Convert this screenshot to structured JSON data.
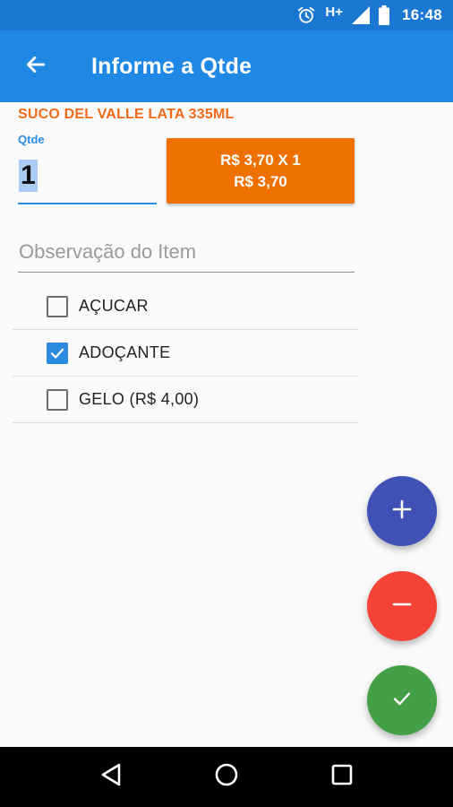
{
  "status_bar": {
    "network": "H+",
    "time": "16:48",
    "icons": [
      "alarm-icon",
      "signal-icon",
      "battery-icon"
    ]
  },
  "toolbar": {
    "title": "Informe a Qtde",
    "back_icon": "arrow-left-icon"
  },
  "product": {
    "name": "SUCO DEL VALLE LATA 335ML"
  },
  "quantity": {
    "label": "Qtde",
    "value": "1"
  },
  "price_button": {
    "line1": "R$ 3,70 X 1",
    "line2": "R$ 3,70"
  },
  "observation": {
    "placeholder": "Observação do Item"
  },
  "options": [
    {
      "label": "AÇUCAR",
      "checked": false
    },
    {
      "label": "ADOÇANTE",
      "checked": true
    },
    {
      "label": "GELO (R$ 4,00)",
      "checked": false
    }
  ],
  "fabs": {
    "add_icon": "plus-icon",
    "remove_icon": "minus-icon",
    "confirm_icon": "check-icon"
  },
  "nav_bar": {
    "icons": [
      "back-triangle-icon",
      "home-circle-icon",
      "recents-square-icon"
    ]
  },
  "colors": {
    "status_bar": "#1a78d2",
    "toolbar": "#1f88e5",
    "product_name": "#f06a1a",
    "accent": "#2b8be0",
    "price_button": "#ee7100",
    "fab_add": "#3f51b5",
    "fab_remove": "#f44336",
    "fab_confirm": "#43a047"
  }
}
